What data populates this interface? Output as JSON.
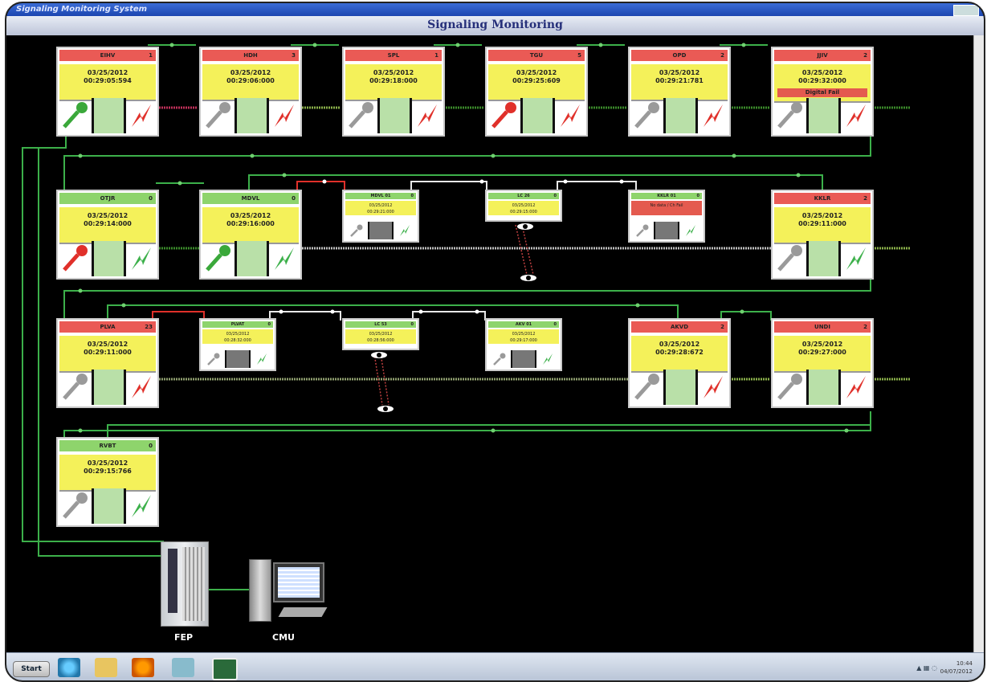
{
  "window": {
    "title": "Signaling Monitoring System"
  },
  "header": {
    "title": "Signaling Monitoring"
  },
  "stations": [
    {
      "name": "EIHV",
      "count": "1",
      "state": "red",
      "date": "03/25/2012",
      "time": "00:29:05:594",
      "key": "green",
      "bolt": "red",
      "fault": ""
    },
    {
      "name": "HDH",
      "count": "3",
      "state": "red",
      "date": "03/25/2012",
      "time": "00:29:06:000",
      "key": "grey",
      "bolt": "red",
      "fault": ""
    },
    {
      "name": "SPL",
      "count": "1",
      "state": "red",
      "date": "03/25/2012",
      "time": "00:29:18:000",
      "key": "grey",
      "bolt": "red",
      "fault": ""
    },
    {
      "name": "TGU",
      "count": "5",
      "state": "red",
      "date": "03/25/2012",
      "time": "00:29:25:609",
      "key": "red",
      "bolt": "red",
      "fault": ""
    },
    {
      "name": "OPD",
      "count": "2",
      "state": "red",
      "date": "03/25/2012",
      "time": "00:29:21:781",
      "key": "grey",
      "bolt": "red",
      "fault": ""
    },
    {
      "name": "JJIV",
      "count": "2",
      "state": "red",
      "date": "03/25/2012",
      "time": "00:29:32:000",
      "key": "grey",
      "bolt": "red",
      "fault": "Digital Fail"
    },
    {
      "name": "OTJR",
      "count": "0",
      "state": "green",
      "date": "03/25/2012",
      "time": "00:29:14:000",
      "key": "red",
      "bolt": "green",
      "fault": ""
    },
    {
      "name": "MDVL",
      "count": "0",
      "state": "green",
      "date": "03/25/2012",
      "time": "00:29:16:000",
      "key": "green",
      "bolt": "green",
      "fault": ""
    },
    {
      "name": "KKLR",
      "count": "2",
      "state": "red",
      "date": "03/25/2012",
      "time": "00:29:11:000",
      "key": "grey",
      "bolt": "green",
      "fault": ""
    },
    {
      "name": "PLVA",
      "count": "23",
      "state": "red",
      "date": "03/25/2012",
      "time": "00:29:11:000",
      "key": "grey",
      "bolt": "red",
      "fault": ""
    },
    {
      "name": "AKVD",
      "count": "2",
      "state": "red",
      "date": "03/25/2012",
      "time": "00:29:28:672",
      "key": "grey",
      "bolt": "red",
      "fault": ""
    },
    {
      "name": "UNDI",
      "count": "2",
      "state": "red",
      "date": "03/25/2012",
      "time": "00:29:27:000",
      "key": "grey",
      "bolt": "red",
      "fault": ""
    },
    {
      "name": "RVBT",
      "count": "0",
      "state": "green",
      "date": "03/25/2012",
      "time": "00:29:15:766",
      "key": "grey",
      "bolt": "green",
      "fault": ""
    }
  ],
  "small_stations": [
    {
      "name": "MDVL 01",
      "count": "0",
      "date": "03/25/2012",
      "time": "00:29:21:000",
      "fault": ""
    },
    {
      "name": "LC 26",
      "count": "0",
      "date": "03/25/2012",
      "time": "00:29:15:000",
      "fault": ""
    },
    {
      "name": "KKLR 01",
      "count": "0",
      "date": "",
      "time": "",
      "fault": "No data / Ch Fail"
    },
    {
      "name": "PLVAT",
      "count": "0",
      "date": "03/25/2012",
      "time": "00:28:32:000",
      "fault": ""
    },
    {
      "name": "LC 53",
      "count": "0",
      "date": "03/25/2012",
      "time": "00:28:56:000",
      "fault": ""
    },
    {
      "name": "AKV 01",
      "count": "0",
      "date": "03/25/2012",
      "time": "00:29:17:000",
      "fault": ""
    }
  ],
  "equipment": {
    "fep": "FEP",
    "cmu": "CMU"
  },
  "taskbar": {
    "start": "Start",
    "time": "10:44",
    "date": "04/07/2012"
  },
  "colors": {
    "red_header": "#ea5a55",
    "green_header": "#8ed46c",
    "timestamp_bg": "#f4f15a",
    "link_green": "#3cb04a",
    "link_red": "#e0302a",
    "link_white": "#e8e8e8"
  }
}
